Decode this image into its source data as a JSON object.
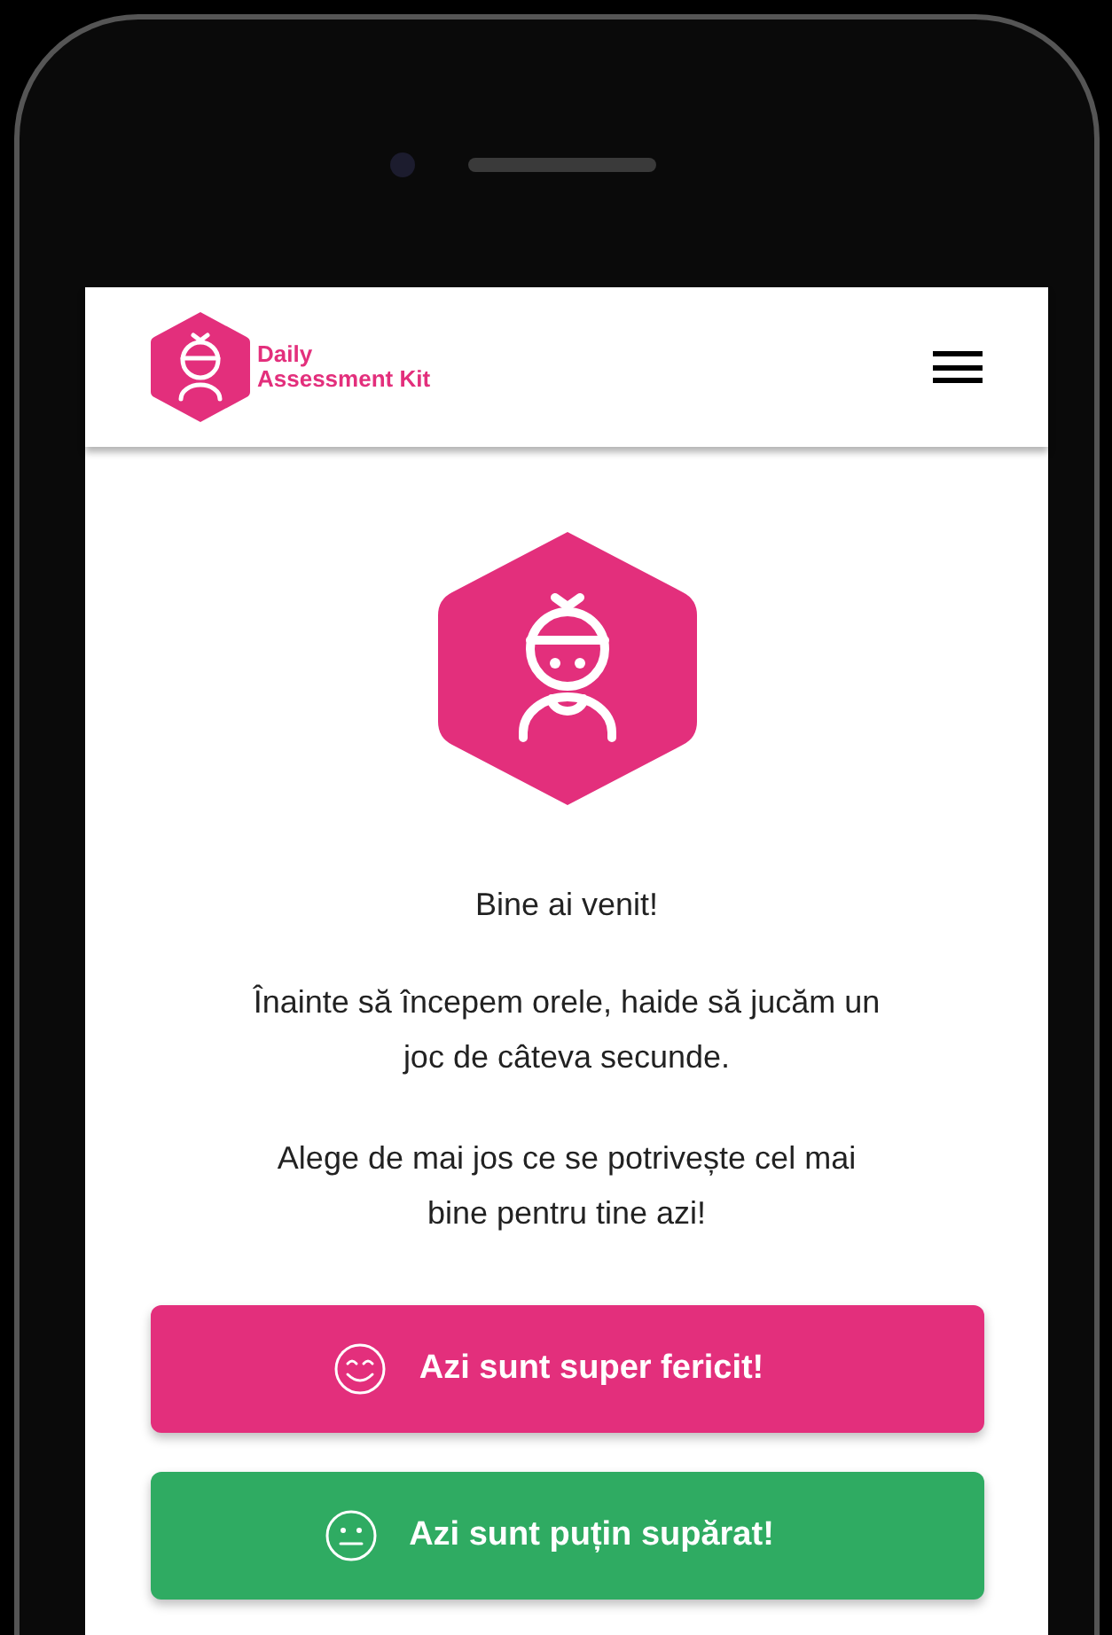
{
  "header": {
    "logo_text_line_1": "Daily",
    "logo_text_line_2": "Assessment Kit"
  },
  "welcome": {
    "title": "Bine ai venit!",
    "paragraphs": [
      "Înainte să începem orele, haide să jucăm un joc de câteva secunde.",
      "Alege de mai jos ce se potrivește cel mai bine pentru tine azi!"
    ]
  },
  "choices": [
    {
      "label": "Azi sunt super fericit!",
      "kind": "happy",
      "color": "#e32f7c"
    },
    {
      "label": "Azi sunt puțin supărat!",
      "kind": "neutral",
      "color": "#2fab62"
    }
  ]
}
